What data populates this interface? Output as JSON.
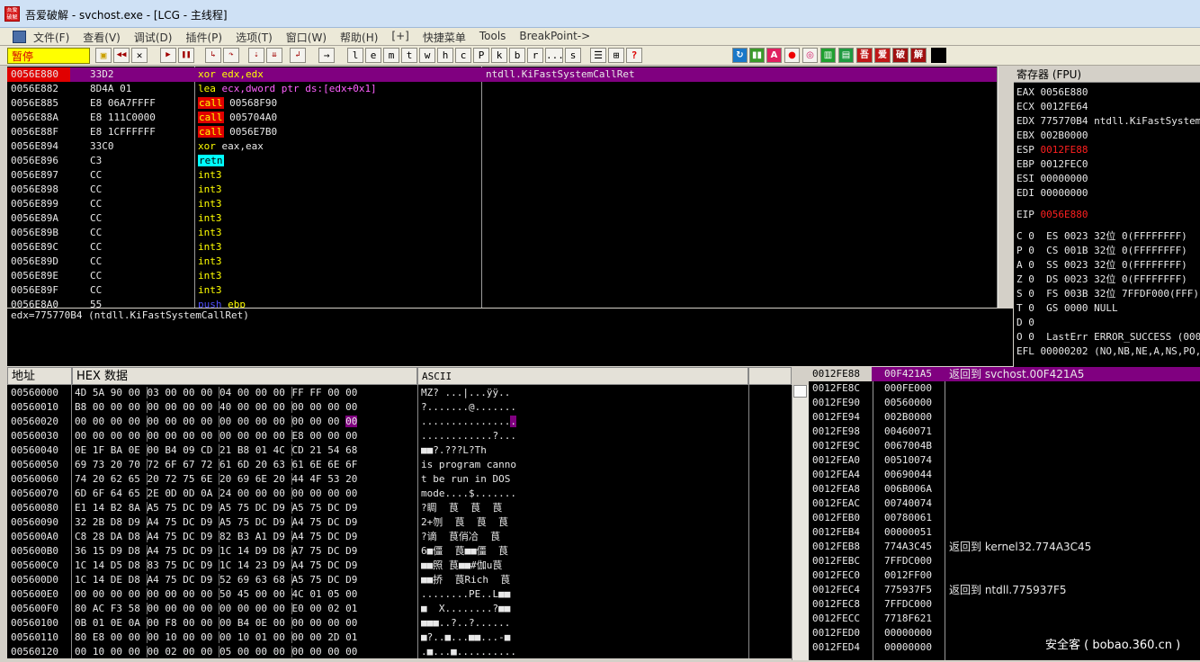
{
  "window": {
    "title": "吾爱破解 - svchost.exe - [LCG - 主线程]",
    "icon_text": "吾爱破解"
  },
  "menu": [
    "文件(F)",
    "查看(V)",
    "调试(D)",
    "插件(P)",
    "选项(T)",
    "窗口(W)",
    "帮助(H)",
    "[+]",
    "快捷菜单",
    "Tools",
    "BreakPoint->"
  ],
  "toolbar": {
    "status": "暂停",
    "letters": [
      "l",
      "e",
      "m",
      "t",
      "w",
      "h",
      "c",
      "P",
      "k",
      "b",
      "r",
      "...",
      "s"
    ],
    "chinese_buttons": [
      "吾",
      "爱",
      "破",
      "解"
    ]
  },
  "disasm": [
    {
      "addr": "0056E880",
      "hex": "33D2",
      "asm": "xor edx,edx",
      "comment": "ntdll.KiFastSystemCallRet"
    },
    {
      "addr": "0056E882",
      "hex": "8D4A 01",
      "asm": "lea ecx,dword ptr ds:[edx+0x1]",
      "comment": ""
    },
    {
      "addr": "0056E885",
      "hex": "E8 06A7FFFF",
      "asm": "call 00568F90",
      "comment": ""
    },
    {
      "addr": "0056E88A",
      "hex": "E8 111C0000",
      "asm": "call 005704A0",
      "comment": ""
    },
    {
      "addr": "0056E88F",
      "hex": "E8 1CFFFFFF",
      "asm": "call 0056E7B0",
      "comment": ""
    },
    {
      "addr": "0056E894",
      "hex": "33C0",
      "asm": "xor eax,eax",
      "comment": ""
    },
    {
      "addr": "0056E896",
      "hex": "C3",
      "asm": "retn",
      "comment": ""
    },
    {
      "addr": "0056E897",
      "hex": "CC",
      "asm": "int3",
      "comment": ""
    },
    {
      "addr": "0056E898",
      "hex": "CC",
      "asm": "int3",
      "comment": ""
    },
    {
      "addr": "0056E899",
      "hex": "CC",
      "asm": "int3",
      "comment": ""
    },
    {
      "addr": "0056E89A",
      "hex": "CC",
      "asm": "int3",
      "comment": ""
    },
    {
      "addr": "0056E89B",
      "hex": "CC",
      "asm": "int3",
      "comment": ""
    },
    {
      "addr": "0056E89C",
      "hex": "CC",
      "asm": "int3",
      "comment": ""
    },
    {
      "addr": "0056E89D",
      "hex": "CC",
      "asm": "int3",
      "comment": ""
    },
    {
      "addr": "0056E89E",
      "hex": "CC",
      "asm": "int3",
      "comment": ""
    },
    {
      "addr": "0056E89F",
      "hex": "CC",
      "asm": "int3",
      "comment": ""
    },
    {
      "addr": "0056E8A0",
      "hex": "55",
      "asm": "push ebp",
      "comment": ""
    }
  ],
  "info_line": "edx=775770B4 (ntdll.KiFastSystemCallRet)",
  "registers": {
    "header": "寄存器 (FPU)",
    "general": [
      {
        "text": "EAX 0056E880",
        "red": false
      },
      {
        "text": "ECX 0012FE64",
        "red": false
      },
      {
        "text": "EDX 775770B4 ntdll.KiFastSystemCallRet",
        "red": false
      },
      {
        "text": "EBX 002B0000",
        "red": false
      },
      {
        "text": "ESP 0012FE88",
        "red": true
      },
      {
        "text": "EBP 0012FEC0",
        "red": false
      },
      {
        "text": "ESI 00000000",
        "red": false
      },
      {
        "text": "EDI 00000000",
        "red": false
      }
    ],
    "eip": "EIP 0056E880",
    "flags": [
      "C 0  ES 0023 32位 0(FFFFFFFF)",
      "P 0  CS 001B 32位 0(FFFFFFFF)",
      "A 0  SS 0023 32位 0(FFFFFFFF)",
      "Z 0  DS 0023 32位 0(FFFFFFFF)",
      "S 0  FS 003B 32位 7FFDF000(FFF)",
      "T 0  GS 0000 NULL",
      "D 0",
      "O 0  LastErr ERROR_SUCCESS (00000000)"
    ],
    "efl": "EFL 00000202 (NO,NB,NE,A,NS,PO,GE,G)"
  },
  "dump": {
    "headers": {
      "address": "地址",
      "hex": "HEX 数据",
      "ascii": "ASCII"
    },
    "rows": [
      {
        "addr": "00560000",
        "hex": "4D 5A 90 00 03 00 00 00 04 00 00 00 FF FF 00 00",
        "ascii": "MZ? ...|...ÿÿ.."
      },
      {
        "addr": "00560010",
        "hex": "B8 00 00 00 00 00 00 00 40 00 00 00 00 00 00 00",
        "ascii": "?.......@......."
      },
      {
        "addr": "00560020",
        "hex": "00 00 00 00 00 00 00 00 00 00 00 00 00 00 00 00",
        "ascii": "................"
      },
      {
        "addr": "00560030",
        "hex": "00 00 00 00 00 00 00 00 00 00 00 00 E8 00 00 00",
        "ascii": "............?..."
      },
      {
        "addr": "00560040",
        "hex": "0E 1F BA 0E 00 B4 09 CD 21 B8 01 4C CD 21 54 68",
        "ascii": "■■?.???L?Th"
      },
      {
        "addr": "00560050",
        "hex": "69 73 20 70 72 6F 67 72 61 6D 20 63 61 6E 6E 6F",
        "ascii": "is program canno"
      },
      {
        "addr": "00560060",
        "hex": "74 20 62 65 20 72 75 6E 20 69 6E 20 44 4F 53 20",
        "ascii": "t be run in DOS "
      },
      {
        "addr": "00560070",
        "hex": "6D 6F 64 65 2E 0D 0D 0A 24 00 00 00 00 00 00 00",
        "ascii": "mode....$......."
      },
      {
        "addr": "00560080",
        "hex": "E1 14 B2 8A A5 75 DC D9 A5 75 DC D9 A5 75 DC D9",
        "ascii": "?睭  茛  茛  茛"
      },
      {
        "addr": "00560090",
        "hex": "32 2B D8 D9 A4 75 DC D9 A5 75 DC D9 A4 75 DC D9",
        "ascii": "2+刎  茛  茛  茛"
      },
      {
        "addr": "005600A0",
        "hex": "C8 28 DA D8 A4 75 DC D9 82 B3 A1 D9 A4 75 DC D9",
        "ascii": "?谪  茛俏冾  茛"
      },
      {
        "addr": "005600B0",
        "hex": "36 15 D9 D8 A4 75 DC D9 1C 14 D9 D8 A7 75 DC D9",
        "ascii": "6■僵  茛■■僵  茛"
      },
      {
        "addr": "005600C0",
        "hex": "1C 14 D5 D8 83 75 DC D9 1C 14 23 D9 A4 75 DC D9",
        "ascii": "■■照 茛■■#伽u茛"
      },
      {
        "addr": "005600D0",
        "hex": "1C 14 DE D8 A4 75 DC D9 52 69 63 68 A5 75 DC D9",
        "ascii": "■■挢  茛Rich  茛"
      },
      {
        "addr": "005600E0",
        "hex": "00 00 00 00 00 00 00 00 50 45 00 00 4C 01 05 00",
        "ascii": "........PE..L■■"
      },
      {
        "addr": "005600F0",
        "hex": "80 AC F3 58 00 00 00 00 00 00 00 00 E0 00 02 01",
        "ascii": "■  X........?■■"
      },
      {
        "addr": "00560100",
        "hex": "0B 01 0E 0A 00 F8 00 00 00 B4 0E 00 00 00 00 00",
        "ascii": "■■■..?..?......"
      },
      {
        "addr": "00560110",
        "hex": "80 E8 00 00 00 10 00 00 00 10 01 00 00 00 2D 01",
        "ascii": "■?..■...■■...-■"
      },
      {
        "addr": "00560120",
        "hex": "00 10 00 00 00 02 00 00 05 00 00 00 00 00 00 00",
        "ascii": ".■...■.........."
      }
    ]
  },
  "stack": [
    {
      "addr": "0012FE88",
      "val": "00F421A5",
      "comment": "返回到 svchost.00F421A5"
    },
    {
      "addr": "0012FE8C",
      "val": "000FE000",
      "comment": ""
    },
    {
      "addr": "0012FE90",
      "val": "00560000",
      "comment": ""
    },
    {
      "addr": "0012FE94",
      "val": "002B0000",
      "comment": ""
    },
    {
      "addr": "0012FE98",
      "val": "00460071",
      "comment": ""
    },
    {
      "addr": "0012FE9C",
      "val": "0067004B",
      "comment": ""
    },
    {
      "addr": "0012FEA0",
      "val": "00510074",
      "comment": ""
    },
    {
      "addr": "0012FEA4",
      "val": "00690044",
      "comment": ""
    },
    {
      "addr": "0012FEA8",
      "val": "006B006A",
      "comment": ""
    },
    {
      "addr": "0012FEAC",
      "val": "00740074",
      "comment": ""
    },
    {
      "addr": "0012FEB0",
      "val": "00780061",
      "comment": ""
    },
    {
      "addr": "0012FEB4",
      "val": "00000051",
      "comment": ""
    },
    {
      "addr": "0012FEB8",
      "val": "774A3C45",
      "comment": "返回到 kernel32.774A3C45"
    },
    {
      "addr": "0012FEBC",
      "val": "7FFDC000",
      "comment": ""
    },
    {
      "addr": "0012FEC0",
      "val": "0012FF00",
      "comment": ""
    },
    {
      "addr": "0012FEC4",
      "val": "775937F5",
      "comment": "返回到 ntdll.775937F5"
    },
    {
      "addr": "0012FEC8",
      "val": "7FFDC000",
      "comment": ""
    },
    {
      "addr": "0012FECC",
      "val": "7718F621",
      "comment": ""
    },
    {
      "addr": "0012FED0",
      "val": "00000000",
      "comment": ""
    },
    {
      "addr": "0012FED4",
      "val": "00000000",
      "comment": ""
    }
  ],
  "watermark": "安全客 ( bobao.360.cn )",
  "colors": {
    "selection": "#800080",
    "call_bg": "#e00000",
    "retn_bg": "#00ffff",
    "mnemonic": "#ffff00",
    "esp_red": "#ff2020"
  }
}
